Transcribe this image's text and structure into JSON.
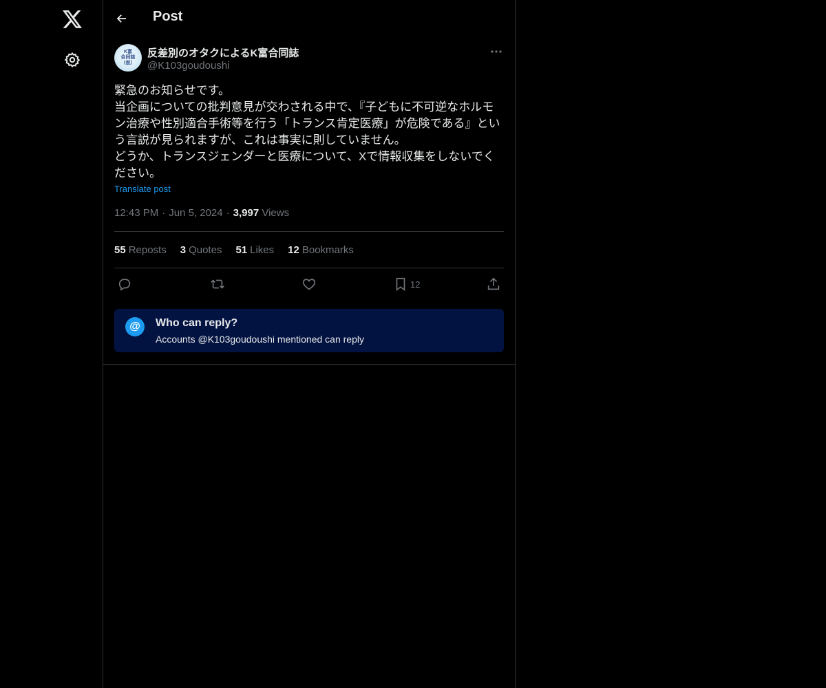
{
  "nav": {
    "logo_icon": "x-logo-icon",
    "settings_icon": "gear-icon"
  },
  "header": {
    "title": "Post",
    "back_icon": "arrow-left-icon"
  },
  "post": {
    "author": {
      "display_name": "反差別のオタクによるK富合同誌",
      "handle": "@K103goudoushi",
      "avatar_text": [
        "K富",
        "合同誌",
        "（仮）"
      ]
    },
    "body_lines": [
      "緊急のお知らせです。",
      "当企画についての批判意見が交わされる中で、『子どもに不可逆なホルモ",
      "ン治療や性別適合手術等を行う「トランス肯定医療」が危険である』とい",
      "う言説が見られますが、これは事実に則していません。",
      "どうか、トランスジェンダーと医療について、Xで情報収集をしないでく",
      "ださい。"
    ],
    "translate_label": "Translate post",
    "time": "12:43 PM",
    "date": "Jun 5, 2024",
    "views_count": "3,997",
    "views_label": "Views",
    "stats": {
      "reposts_count": "55",
      "reposts_label": "Reposts",
      "quotes_count": "3",
      "quotes_label": "Quotes",
      "likes_count": "51",
      "likes_label": "Likes",
      "bookmarks_count": "12",
      "bookmarks_label": "Bookmarks"
    },
    "actions": {
      "bookmark_count": "12"
    }
  },
  "reply_restriction": {
    "icon": "@",
    "title": "Who can reply?",
    "subtitle": "Accounts @K103goudoushi mentioned can reply"
  },
  "colors": {
    "background": "#000000",
    "text": "#e7e9ea",
    "muted": "#71767b",
    "accent": "#1d9bf0",
    "border": "#2f3336",
    "reply_box": "#031341"
  }
}
